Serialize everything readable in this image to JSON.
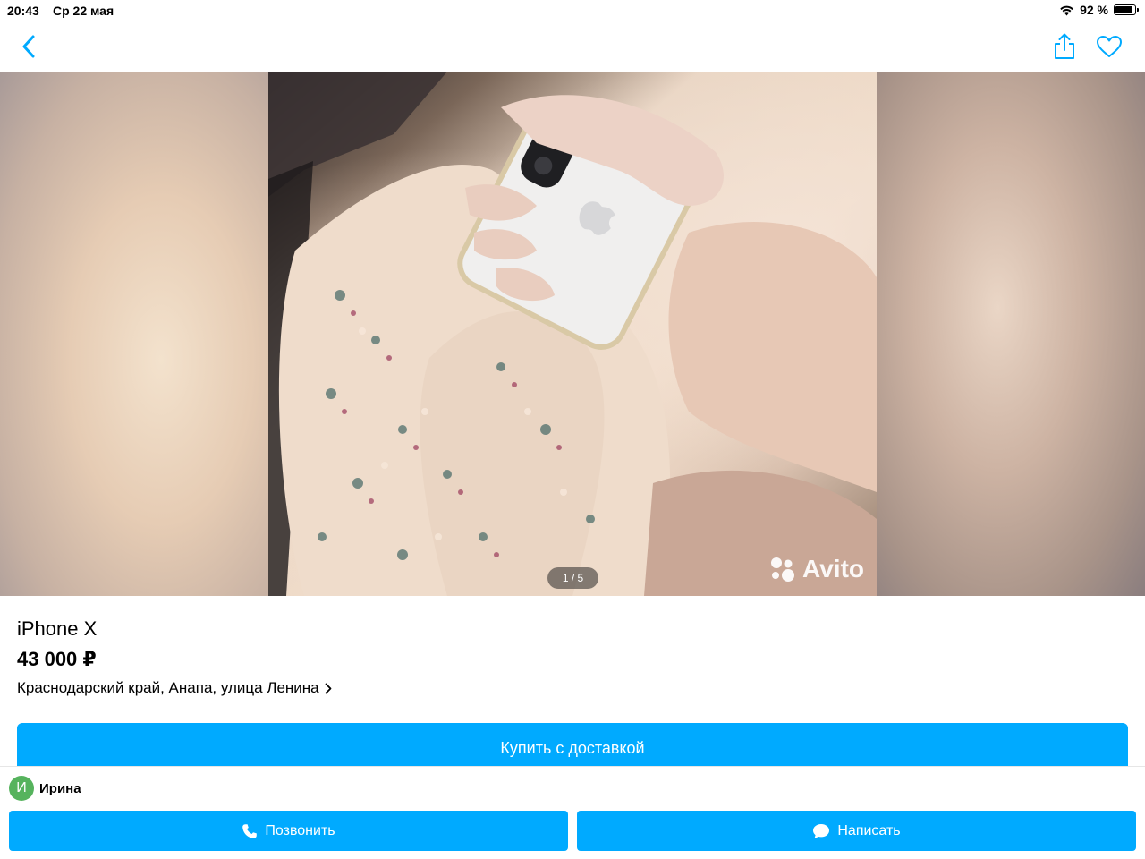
{
  "status_bar": {
    "time": "20:43",
    "date": "Ср 22 мая",
    "battery_label": "92 %",
    "battery_level": 0.92
  },
  "nav": {
    "back_icon": "chevron-left-icon",
    "share_icon": "share-icon",
    "favorite_icon": "heart-icon"
  },
  "gallery": {
    "watermark": "Avito",
    "page_indicator": "1 / 5"
  },
  "listing": {
    "title": "iPhone X",
    "price": "43 000 ₽",
    "location": "Краснодарский край, Анапа, улица Ленина"
  },
  "buy_button_label": "Купить с доставкой",
  "seller": {
    "initial": "И",
    "name": "Ирина"
  },
  "actions": {
    "call_label": "Позвонить",
    "message_label": "Написать"
  },
  "colors": {
    "accent": "#00aaff",
    "avatar": "#56b35d"
  }
}
